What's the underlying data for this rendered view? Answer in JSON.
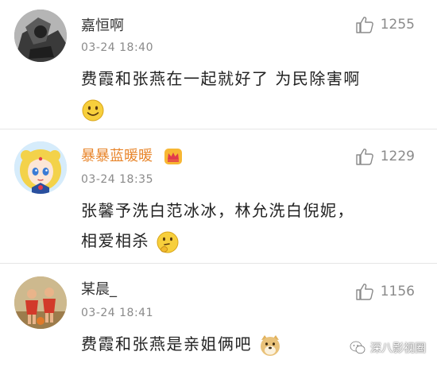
{
  "comments": [
    {
      "username": "嘉恒啊",
      "timestamp": "03-24 18:40",
      "likes": "1255",
      "text_lines": [
        "费霞和张燕在一起就好了 为民除害啊"
      ],
      "emoji": "smile-emoji"
    },
    {
      "username": "暴暴蓝暖暖",
      "timestamp": "03-24 18:35",
      "likes": "1229",
      "text_lines": [
        "张馨予洗白范冰冰，林允洗白倪妮，",
        "相爱相杀"
      ],
      "emoji": "thinking-emoji",
      "badge": "crown-icon",
      "username_color": "#e8862c"
    },
    {
      "username": "某晨_",
      "timestamp": "03-24 18:41",
      "likes": "1156",
      "text_lines": [
        "费霞和张燕是亲姐俩吧"
      ],
      "emoji": "doge-emoji"
    }
  ],
  "watermark": {
    "text": "深八影视圈"
  }
}
